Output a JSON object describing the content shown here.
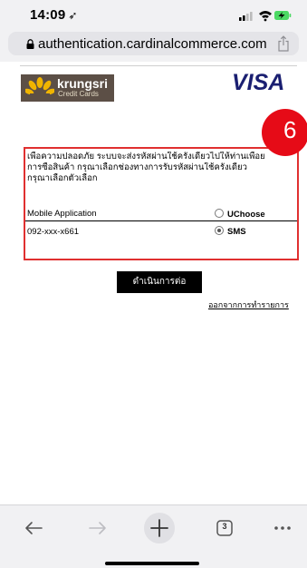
{
  "status_bar": {
    "time": "14:09",
    "location_glyph": "➶"
  },
  "browser": {
    "url": "authentication.cardinalcommerce.com",
    "tabs_count": "3",
    "icons": [
      "lock-icon",
      "share-icon",
      "back-icon",
      "forward-icon",
      "new-tab-icon",
      "tabs-icon",
      "more-icon"
    ]
  },
  "page": {
    "bank_logo": {
      "name": "krungsri",
      "sub": "Credit Cards"
    },
    "visa_logo": "VISA",
    "step_badge": "6",
    "notice_lines": [
      "เพื่อความปลอดภัย ระบบจะส่งรหัสผ่านใช้ครั้งเดียวไปให้ท่านเพื่อย",
      "การซื้อสินค้า กรุณาเลือกช่องทางการรับรหัสผ่านใช้ครั้งเดียว",
      "กรุณาเลือกตัวเลือก"
    ],
    "options": [
      {
        "label": "Mobile Application",
        "choice": "UChoose",
        "selected": false
      },
      {
        "label": "092-xxx-x661",
        "choice": "SMS",
        "selected": true
      }
    ],
    "continue_label": "ดำเนินการต่อ",
    "exit_label": "ออกจากการทำรายการ"
  },
  "colors": {
    "badge": "#e60b17",
    "box_border": "#e03030",
    "visa": "#1a1f71",
    "krungsri_bg": "#5c4f46",
    "krungsri_accent": "#f0b400"
  }
}
